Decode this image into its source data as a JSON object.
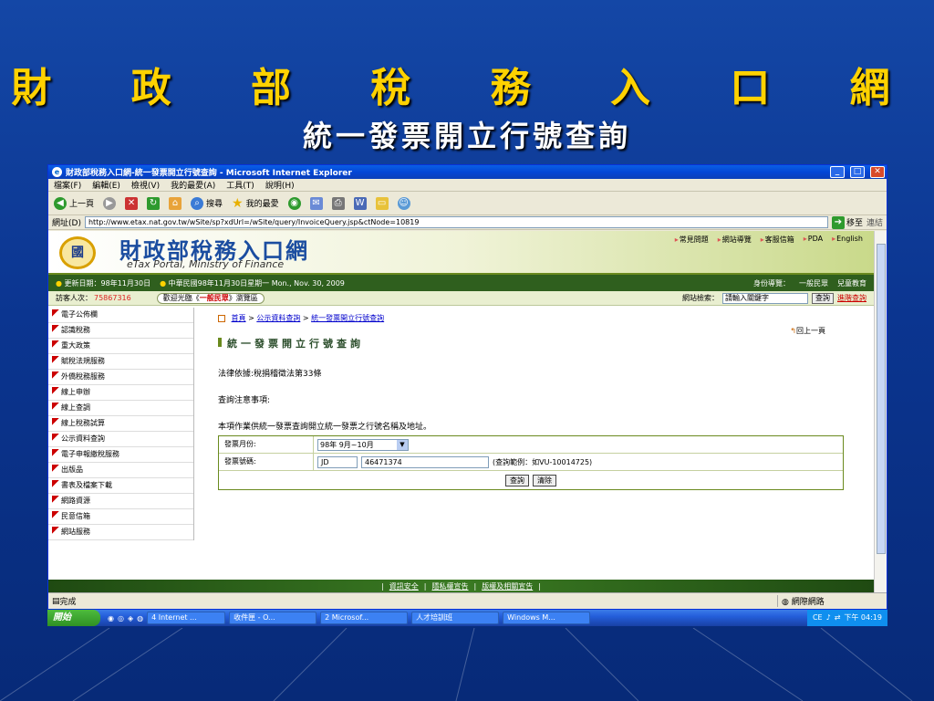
{
  "slide": {
    "title": "財 政 部 稅 務 入 口 網",
    "subtitle": "統一發票開立行號查詢"
  },
  "window": {
    "title": "財政部稅務入口網-統一發票開立行號查詢 - Microsoft Internet Explorer",
    "min": "_",
    "max": "□",
    "close": "✕"
  },
  "menu": [
    "檔案(F)",
    "編輯(E)",
    "檢視(V)",
    "我的最愛(A)",
    "工具(T)",
    "說明(H)"
  ],
  "toolbar": {
    "back": "上一頁",
    "search": "搜尋",
    "favorites": "我的最愛"
  },
  "address": {
    "label": "網址(D)",
    "url": "http://www.etax.nat.gov.tw/wSite/sp?xdUrl=/wSite/query/InvoiceQuery.jsp&ctNode=10819",
    "go": "移至",
    "links": "連結"
  },
  "site": {
    "logo": "國",
    "name": "財政部稅務入口網",
    "en": "eTax Portal, Ministry of Finance",
    "toplinks": [
      "常見問題",
      "網站導覽",
      "客服信箱",
      "PDA",
      "English"
    ]
  },
  "datebar": {
    "updated": "更新日期：98年11月30日",
    "today": "中華民國98年11月30日星期一 Mon., Nov. 30, 2009",
    "guide": "身份導覽：",
    "general": "一般民眾",
    "kids": "兒童教育"
  },
  "visit": {
    "label": "訪客人次：",
    "count": "75867316",
    "welcome_pre": "歡迎光臨《",
    "welcome_role": "一般民眾",
    "welcome_post": "》瀏覽區",
    "search_label": "網站檢索：",
    "search_placeholder": "請輸入關鍵字",
    "search_btn": "查詢",
    "advanced": "進階查詢"
  },
  "sidebar": [
    "電子公佈欄",
    "認識稅務",
    "重大政策",
    "賦稅法規服務",
    "外僑稅務服務",
    "線上申辦",
    "線上查調",
    "線上稅務試算",
    "公示資料查詢",
    "電子申報繳稅服務",
    "出版品",
    "書表及檔案下載",
    "網路資源",
    "民意信箱",
    "網站服務"
  ],
  "breadcrumb": {
    "home": "首頁",
    "sep1": " > ",
    "mid": "公示資料查詢",
    "sep2": " > ",
    "current": "統一發票開立行號查詢"
  },
  "page": {
    "title": "統一發票開立行號查詢",
    "back": "回上一頁",
    "law": "法律依據:稅捐稽徵法第33條",
    "notes": "查詢注意事項:",
    "desc": "本項作業供統一發票查詢開立統一發票之行號名稱及地址。"
  },
  "form": {
    "month_label": "發票月份:",
    "month_value": "98年 9月~10月",
    "number_label": "發票號碼:",
    "prefix": "JD",
    "number": "46471374",
    "hint": "(查詢範例：如VU-10014725)",
    "submit": "查詢",
    "clear": "清除"
  },
  "footer": {
    "links": [
      "資訊安全",
      "隱私權宣告",
      "版權及相關宣告"
    ]
  },
  "status": {
    "left": "完成",
    "right": "網際網路"
  },
  "taskbar": {
    "start": "開始",
    "tasks": [
      "4 Internet ...",
      "收件匣 - O...",
      "2 Microsof...",
      "人才培訓班",
      "Windows M..."
    ],
    "tray": "CE",
    "clock": "下午 04:19"
  }
}
